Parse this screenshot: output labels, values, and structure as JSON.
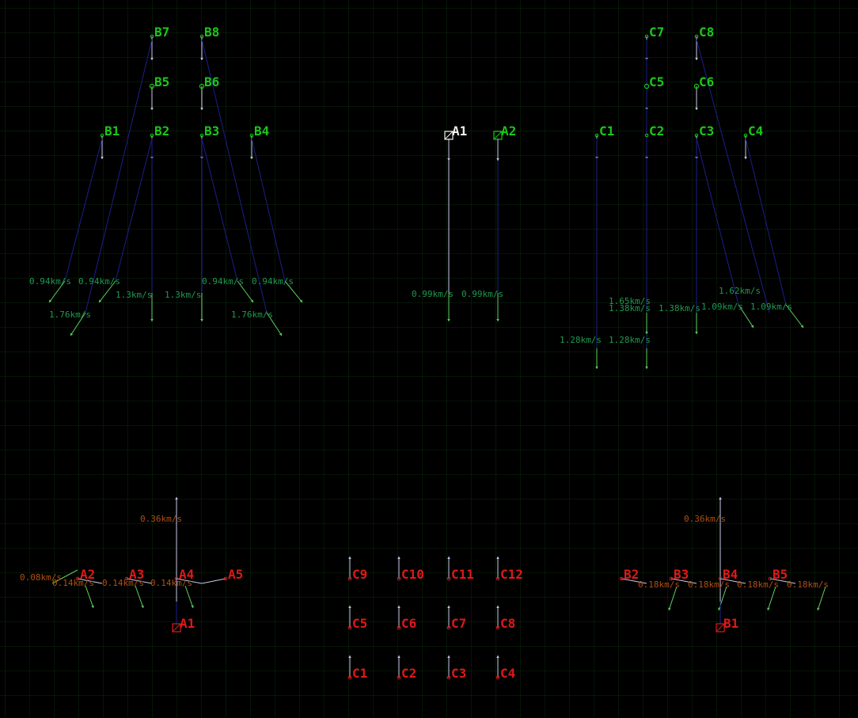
{
  "colors": {
    "background": "#000000",
    "grid": "#0d2a0d",
    "green_label": "#19c819",
    "red_label": "#e01818",
    "white_label": "#f0f0f0",
    "speed_green": "#1e9a50",
    "speed_orange": "#b05010",
    "link_line": "#1b1f8a",
    "white_line": "#c8c8e8",
    "arrow_green": "#60d060"
  },
  "upper_groups": {
    "B": {
      "labels": [
        "B7",
        "B8",
        "B5",
        "B6",
        "B1",
        "B2",
        "B3",
        "B4"
      ],
      "speeds": [
        "0.94km/s",
        "0.94km/s",
        "1.3km/s",
        "1.3km/s",
        "0.94km/s",
        "0.94km/s",
        "1.76km/s",
        "1.76km/s"
      ]
    },
    "A": {
      "labels": [
        "A1",
        "A2"
      ],
      "speeds": [
        "0.99km/s",
        "0.99km/s"
      ]
    },
    "C": {
      "labels": [
        "C7",
        "C8",
        "C5",
        "C6",
        "C1",
        "C2",
        "C3",
        "C4"
      ],
      "speeds": [
        "1.62km/s",
        "1.65km/s",
        "1.38km/s",
        "1.38km/s",
        "1.09km/s",
        "1.09km/s",
        "1.28km/s",
        "1.28km/s"
      ]
    }
  },
  "lower_groups": {
    "A": {
      "labels": [
        "A2",
        "A3",
        "A4",
        "A5",
        "A1"
      ],
      "speeds": [
        "0.08km/s",
        "0.14km/s",
        "0.14km/s",
        "0.14km/s",
        "0.36km/s"
      ]
    },
    "C": {
      "labels": [
        "C9",
        "C10",
        "C11",
        "C12",
        "C5",
        "C6",
        "C7",
        "C8",
        "C1",
        "C2",
        "C3",
        "C4"
      ]
    },
    "B": {
      "labels": [
        "B2",
        "B3",
        "B4",
        "B5",
        "B1"
      ],
      "speeds": [
        "0.18km/s",
        "0.18km/s",
        "0.18km/s",
        "0.18km/s",
        "0.36km/s"
      ]
    }
  }
}
